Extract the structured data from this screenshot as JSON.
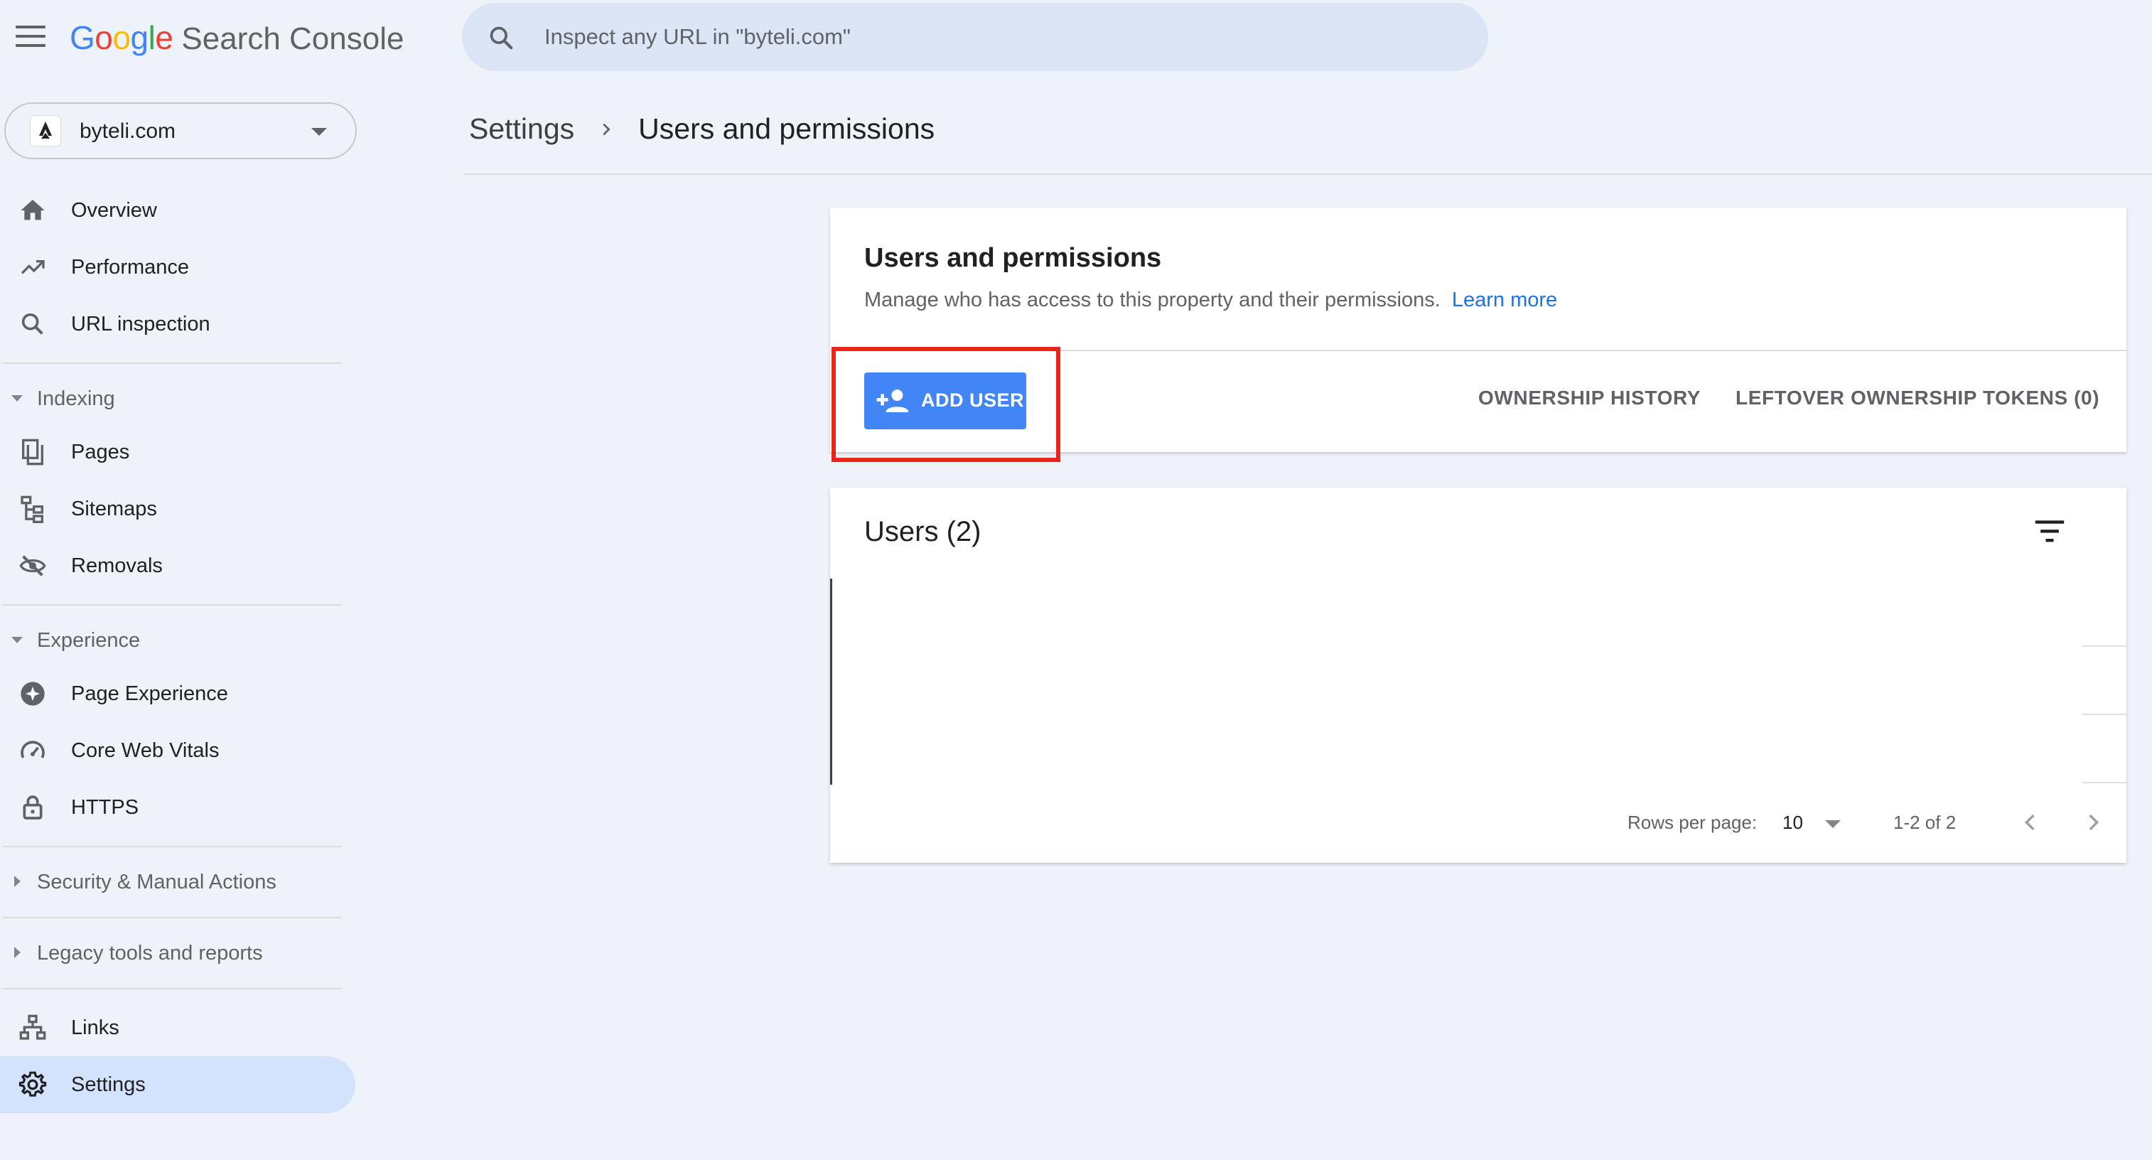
{
  "app": {
    "logo_google": [
      "G",
      "o",
      "o",
      "g",
      "l",
      "e"
    ],
    "logo_product": "Search Console"
  },
  "search": {
    "placeholder": "Inspect any URL in \"byteli.com\""
  },
  "property": {
    "name": "byteli.com"
  },
  "sidebar": {
    "items": [
      {
        "label": "Overview",
        "icon": "home-icon"
      },
      {
        "label": "Performance",
        "icon": "trending-up-icon"
      },
      {
        "label": "URL inspection",
        "icon": "search-icon"
      }
    ],
    "groups": {
      "indexing": {
        "label": "Indexing",
        "items": [
          {
            "label": "Pages",
            "icon": "pages-icon"
          },
          {
            "label": "Sitemaps",
            "icon": "sitemap-icon"
          },
          {
            "label": "Removals",
            "icon": "visibility-off-icon"
          }
        ]
      },
      "experience": {
        "label": "Experience",
        "items": [
          {
            "label": "Page Experience",
            "icon": "page-experience-icon"
          },
          {
            "label": "Core Web Vitals",
            "icon": "speedometer-icon"
          },
          {
            "label": "HTTPS",
            "icon": "lock-icon"
          }
        ]
      },
      "security": {
        "label": "Security & Manual Actions"
      },
      "legacy": {
        "label": "Legacy tools and reports"
      }
    },
    "bottom_items": [
      {
        "label": "Links",
        "icon": "links-icon"
      },
      {
        "label": "Settings",
        "icon": "gear-icon",
        "active": true
      }
    ]
  },
  "breadcrumb": {
    "parent": "Settings",
    "current": "Users and permissions"
  },
  "permissions_card": {
    "title": "Users and permissions",
    "description": "Manage who has access to this property and their permissions.",
    "learn_more": "Learn more",
    "add_user": "ADD USER",
    "ownership_history": "OWNERSHIP HISTORY",
    "leftover_tokens": "LEFTOVER OWNERSHIP TOKENS (0)"
  },
  "users_card": {
    "title": "Users (2)",
    "rows_per_page_label": "Rows per page:",
    "rows_per_page_value": "10",
    "range": "1-2 of 2"
  },
  "colors": {
    "accent": "#4285f4",
    "active_nav": "#d3e3fd",
    "highlight": "#e8241b",
    "link": "#1a73e8"
  }
}
